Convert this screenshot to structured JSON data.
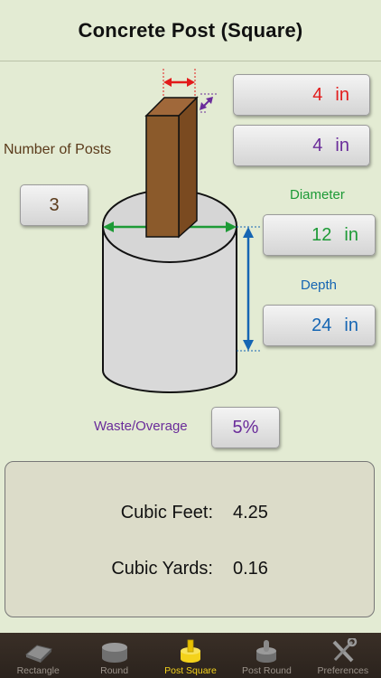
{
  "header": {
    "title": "Concrete Post (Square)"
  },
  "inputs": {
    "width": {
      "value": "4",
      "unit": "in",
      "color": "#e21b1b"
    },
    "thickness": {
      "value": "4",
      "unit": "in",
      "color": "#6a2c9a"
    },
    "posts": {
      "label": "Number of Posts",
      "value": "3",
      "label_color": "#5a3a1a"
    },
    "diameter": {
      "label": "Diameter",
      "value": "12",
      "unit": "in",
      "color": "#1d9a36"
    },
    "depth": {
      "label": "Depth",
      "value": "24",
      "unit": "in",
      "color": "#1565b3"
    },
    "waste": {
      "label": "Waste/Overage",
      "value": "5%",
      "color": "#6a2c9a"
    }
  },
  "results": {
    "cubic_feet_label": "Cubic Feet:",
    "cubic_feet_value": "4.25",
    "cubic_yards_label": "Cubic Yards:",
    "cubic_yards_value": "0.16"
  },
  "tabs": [
    {
      "label": "Rectangle",
      "icon": "slab-icon",
      "active": false
    },
    {
      "label": "Round",
      "icon": "cylinder-icon",
      "active": false
    },
    {
      "label": "Post Square",
      "icon": "post-square-icon",
      "active": true
    },
    {
      "label": "Post Round",
      "icon": "post-round-icon",
      "active": false
    },
    {
      "label": "Preferences",
      "icon": "tools-icon",
      "active": false
    }
  ],
  "colors": {
    "background": "#e3ebd3",
    "post_wood": "#8b5a2b",
    "tab_active": "#f4d21b"
  }
}
